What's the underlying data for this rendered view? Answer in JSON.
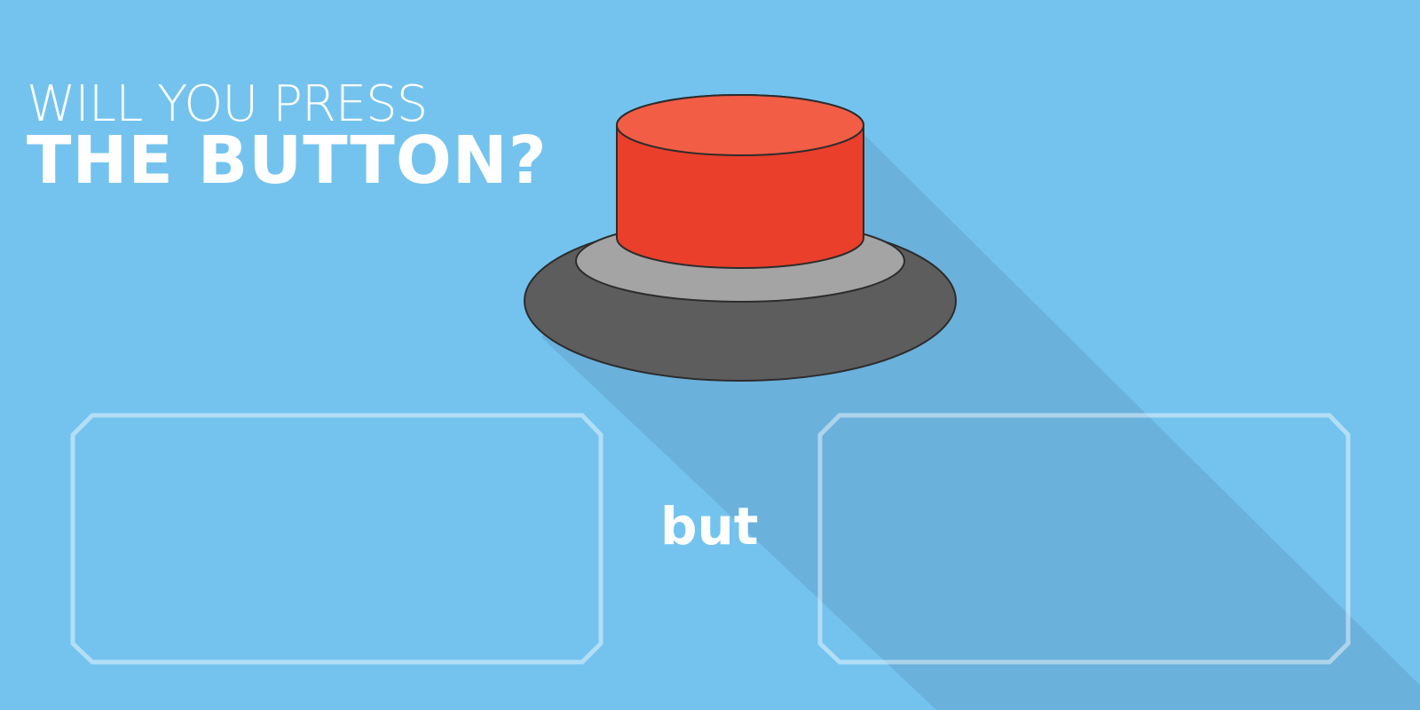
{
  "header": {
    "line1": "WILL YOU PRESS",
    "line2": "THE BUTTON?"
  },
  "main": {
    "conjunction": "but",
    "option_left_text": "",
    "option_right_text": ""
  },
  "colors": {
    "background": "#74c3ef",
    "shadow": "#6ab1dc",
    "button_top": "#f25d45",
    "button_side": "#e93f2b",
    "ring_light": "#a4a4a4",
    "ring_dark": "#5d5d5d",
    "outline": "#ffffff"
  },
  "icons": {
    "button": "red-button-icon"
  }
}
